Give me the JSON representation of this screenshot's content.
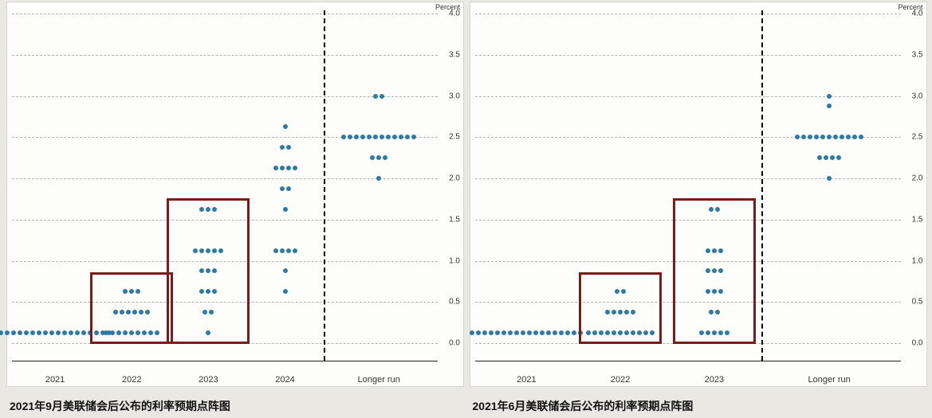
{
  "chart_data": [
    {
      "type": "dot_plot",
      "title": "2021年9月美联储会后公布的利率预期点阵图",
      "ylabel": "Percent",
      "ylim": [
        0,
        4.0
      ],
      "yticks": [
        0.0,
        0.5,
        1.0,
        1.5,
        2.0,
        2.5,
        3.0,
        3.5,
        4.0
      ],
      "categories": [
        "2021",
        "2022",
        "2023",
        "2024",
        "Longer run"
      ],
      "series": [
        {
          "name": "2021",
          "values": {
            "0.125": 18
          }
        },
        {
          "name": "2022",
          "values": {
            "0.125": 9,
            "0.375": 6,
            "0.625": 3
          }
        },
        {
          "name": "2023",
          "values": {
            "0.125": 1,
            "0.375": 2,
            "0.625": 3,
            "0.875": 3,
            "1.125": 5,
            "1.625": 3
          }
        },
        {
          "name": "2024",
          "values": {
            "0.625": 1,
            "0.875": 1,
            "1.125": 4,
            "1.625": 1,
            "1.875": 2,
            "2.125": 4,
            "2.375": 2,
            "2.625": 1
          }
        },
        {
          "name": "Longer run",
          "values": {
            "2.0": 1,
            "2.25": 3,
            "2.5": 12,
            "3.0": 2
          }
        }
      ],
      "highlight_boxes": [
        {
          "category": "2022",
          "y_range": [
            0.05,
            0.8
          ]
        },
        {
          "category": "2023",
          "y_range": [
            0.05,
            1.7
          ]
        }
      ]
    },
    {
      "type": "dot_plot",
      "title": "2021年6月美联储会后公布的利率预期点阵图",
      "ylabel": "Percent",
      "ylim": [
        0,
        4.0
      ],
      "yticks": [
        0.0,
        0.5,
        1.0,
        1.5,
        2.0,
        2.5,
        3.0,
        3.5,
        4.0
      ],
      "categories": [
        "2021",
        "2022",
        "2023",
        "Longer run"
      ],
      "series": [
        {
          "name": "2021",
          "values": {
            "0.125": 18
          }
        },
        {
          "name": "2022",
          "values": {
            "0.125": 11,
            "0.375": 5,
            "0.625": 2
          }
        },
        {
          "name": "2023",
          "values": {
            "0.125": 5,
            "0.375": 2,
            "0.625": 3,
            "0.875": 3,
            "1.125": 3,
            "1.625": 2
          }
        },
        {
          "name": "Longer run",
          "values": {
            "2.0": 1,
            "2.25": 4,
            "2.5": 11,
            "2.875": 1,
            "3.0": 1
          }
        }
      ],
      "highlight_boxes": [
        {
          "category": "2022",
          "y_range": [
            0.05,
            0.8
          ]
        },
        {
          "category": "2023",
          "y_range": [
            0.05,
            1.7
          ]
        }
      ]
    }
  ]
}
